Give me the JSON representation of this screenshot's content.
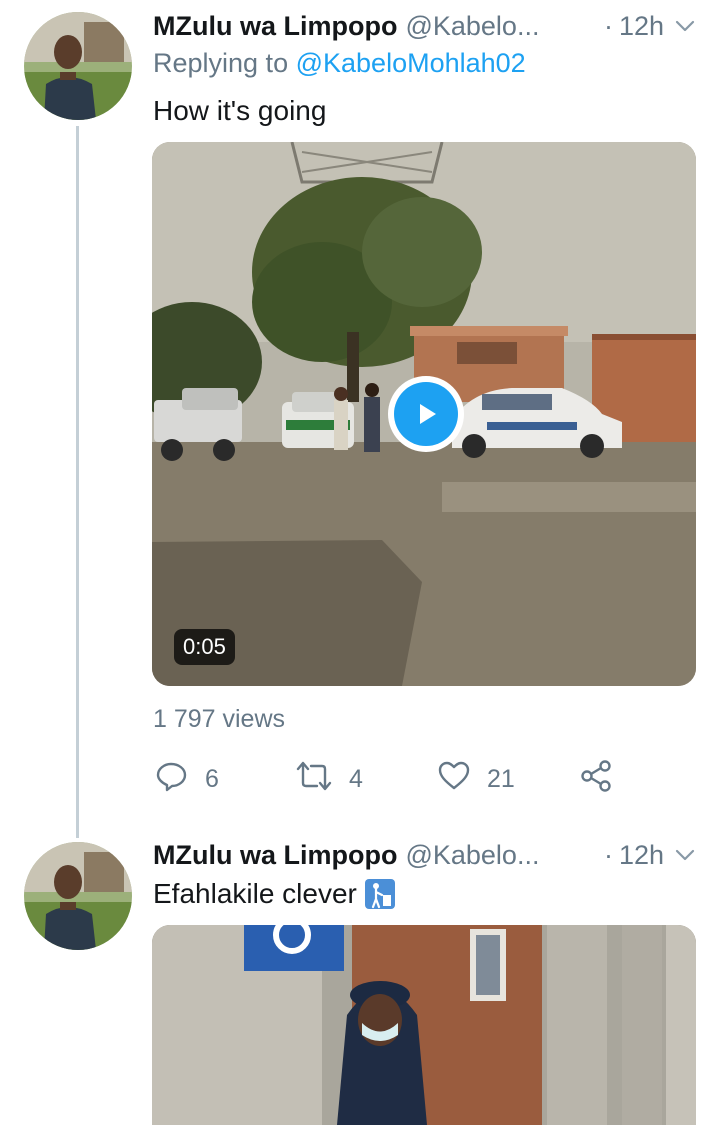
{
  "tweets": [
    {
      "display_name": "MZulu wa Limpopo",
      "handle": "@Kabelo...",
      "time": "12h",
      "replying_label": "Replying to",
      "replying_mention": "@KabeloMohlah02",
      "text": "How it's going",
      "video_duration": "0:05",
      "views": "1 797 views",
      "replies": "6",
      "retweets": "4",
      "likes": "21"
    },
    {
      "display_name": "MZulu wa Limpopo",
      "handle": "@Kabelo...",
      "time": "12h",
      "text": "Efahlakile clever",
      "emoji": "put-litter-in-its-place-icon"
    }
  ],
  "colors": {
    "accent": "#1da1f2",
    "secondary_text": "#657786",
    "thread_line": "#c4cfd6"
  }
}
